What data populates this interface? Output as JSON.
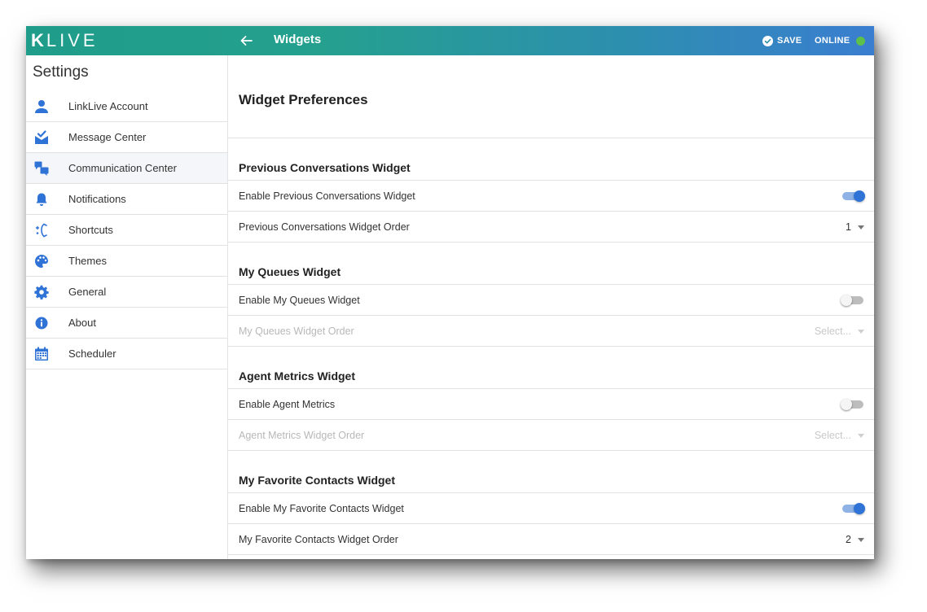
{
  "app": {
    "logo_k": "K",
    "logo_rest": "LIVE",
    "title": "Widgets",
    "save_label": "SAVE",
    "status_label": "ONLINE",
    "status_color": "#5cc04b"
  },
  "sidebar": {
    "heading": "Settings",
    "items": [
      {
        "label": "LinkLive Account",
        "icon": "person-icon"
      },
      {
        "label": "Message Center",
        "icon": "mail-check-icon"
      },
      {
        "label": "Communication Center",
        "icon": "chat-bubbles-icon",
        "active": true
      },
      {
        "label": "Notifications",
        "icon": "bell-icon"
      },
      {
        "label": "Shortcuts",
        "icon": "shortcut-icon"
      },
      {
        "label": "Themes",
        "icon": "palette-icon"
      },
      {
        "label": "General",
        "icon": "gear-icon"
      },
      {
        "label": "About",
        "icon": "info-icon"
      },
      {
        "label": "Scheduler",
        "icon": "calendar-icon"
      }
    ]
  },
  "main": {
    "title": "Widget Preferences",
    "sections": [
      {
        "title": "Previous Conversations Widget",
        "enable_label": "Enable Previous Conversations Widget",
        "enabled": true,
        "order_label": "Previous Conversations Widget Order",
        "order_value": "1"
      },
      {
        "title": "My Queues Widget",
        "enable_label": "Enable My Queues Widget",
        "enabled": false,
        "order_label": "My Queues Widget Order",
        "order_value": "Select..."
      },
      {
        "title": "Agent Metrics Widget",
        "enable_label": "Enable Agent Metrics",
        "enabled": false,
        "order_label": "Agent Metrics Widget Order",
        "order_value": "Select..."
      },
      {
        "title": "My Favorite Contacts Widget",
        "enable_label": "Enable My Favorite Contacts Widget",
        "enabled": true,
        "order_label": "My Favorite Contacts Widget Order",
        "order_value": "2"
      }
    ]
  },
  "colors": {
    "accent": "#2f73d6",
    "header_start": "#1f9c8a",
    "header_end": "#3a7ed0"
  }
}
